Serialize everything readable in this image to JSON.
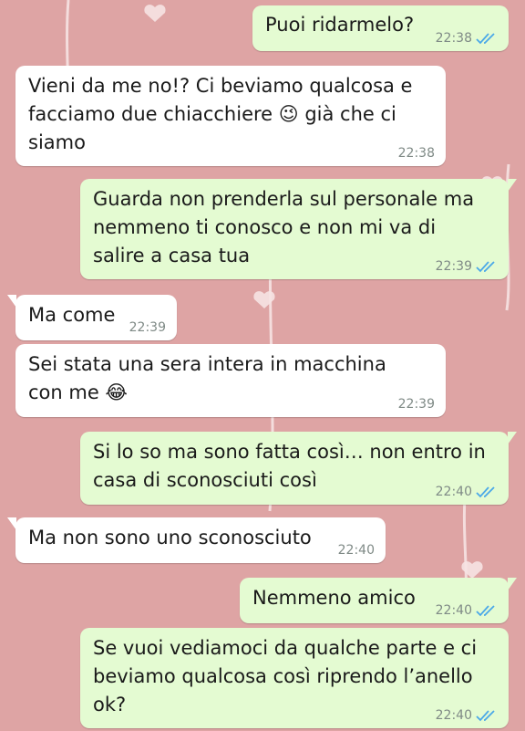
{
  "colors": {
    "background": "#dea4a4",
    "incoming_bubble": "#ffffff",
    "outgoing_bubble": "#e4fbd2",
    "read_ticks": "#4aa8e8",
    "timestamp": "#7f8a86"
  },
  "messages": [
    {
      "direction": "outgoing",
      "text": "Puoi ridarmelo?",
      "time": "22:38",
      "status": "read"
    },
    {
      "direction": "incoming",
      "text": "Vieni da me no!? Ci beviamo qualcosa e\nfacciamo due chiacchiere 😉 già che ci\nsiamo",
      "time": "22:38"
    },
    {
      "direction": "outgoing",
      "text": "Guarda non prenderla sul personale ma\nnemmeno ti conosco e non mi va di\nsalire a casa tua",
      "time": "22:39",
      "status": "read"
    },
    {
      "direction": "incoming",
      "text": "Ma come",
      "time": "22:39"
    },
    {
      "direction": "incoming",
      "text": "Sei stata una sera intera in macchina\ncon me 😂",
      "time": "22:39"
    },
    {
      "direction": "outgoing",
      "text": "Si lo so ma sono fatta così… non entro in\ncasa di sconosciuti così",
      "time": "22:40",
      "status": "read"
    },
    {
      "direction": "incoming",
      "text": "Ma non sono uno sconosciuto",
      "time": "22:40"
    },
    {
      "direction": "outgoing",
      "text": "Nemmeno amico",
      "time": "22:40",
      "status": "read"
    },
    {
      "direction": "outgoing",
      "text": "Se vuoi vediamoci da qualche parte e ci\nbeviamo qualcosa così riprendo l’anello\nok?",
      "time": "22:40",
      "status": "read"
    }
  ]
}
